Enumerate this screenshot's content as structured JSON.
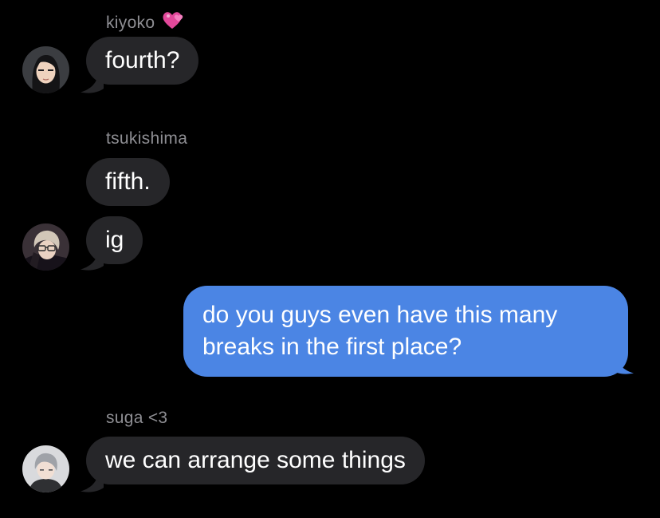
{
  "colors": {
    "background": "#000000",
    "incoming_bubble": "#262629",
    "outgoing_bubble": "#4b85e4",
    "sender_name": "#8e8e93",
    "text": "#ffffff"
  },
  "messages": [
    {
      "sender": "kiyoko",
      "sender_emoji": "revolving-hearts-emoji",
      "avatar": "avatar-kiyoko",
      "bubbles": [
        "fourth?"
      ]
    },
    {
      "sender": "tsukishima",
      "avatar": "avatar-tsukishima",
      "bubbles": [
        "fifth.",
        "ig"
      ]
    },
    {
      "sender": "me",
      "direction": "outgoing",
      "lines": [
        "do you guys even have this many",
        "breaks in the first place?"
      ]
    },
    {
      "sender": "suga <3",
      "avatar": "avatar-suga",
      "bubbles": [
        "we can arrange some things"
      ]
    }
  ]
}
